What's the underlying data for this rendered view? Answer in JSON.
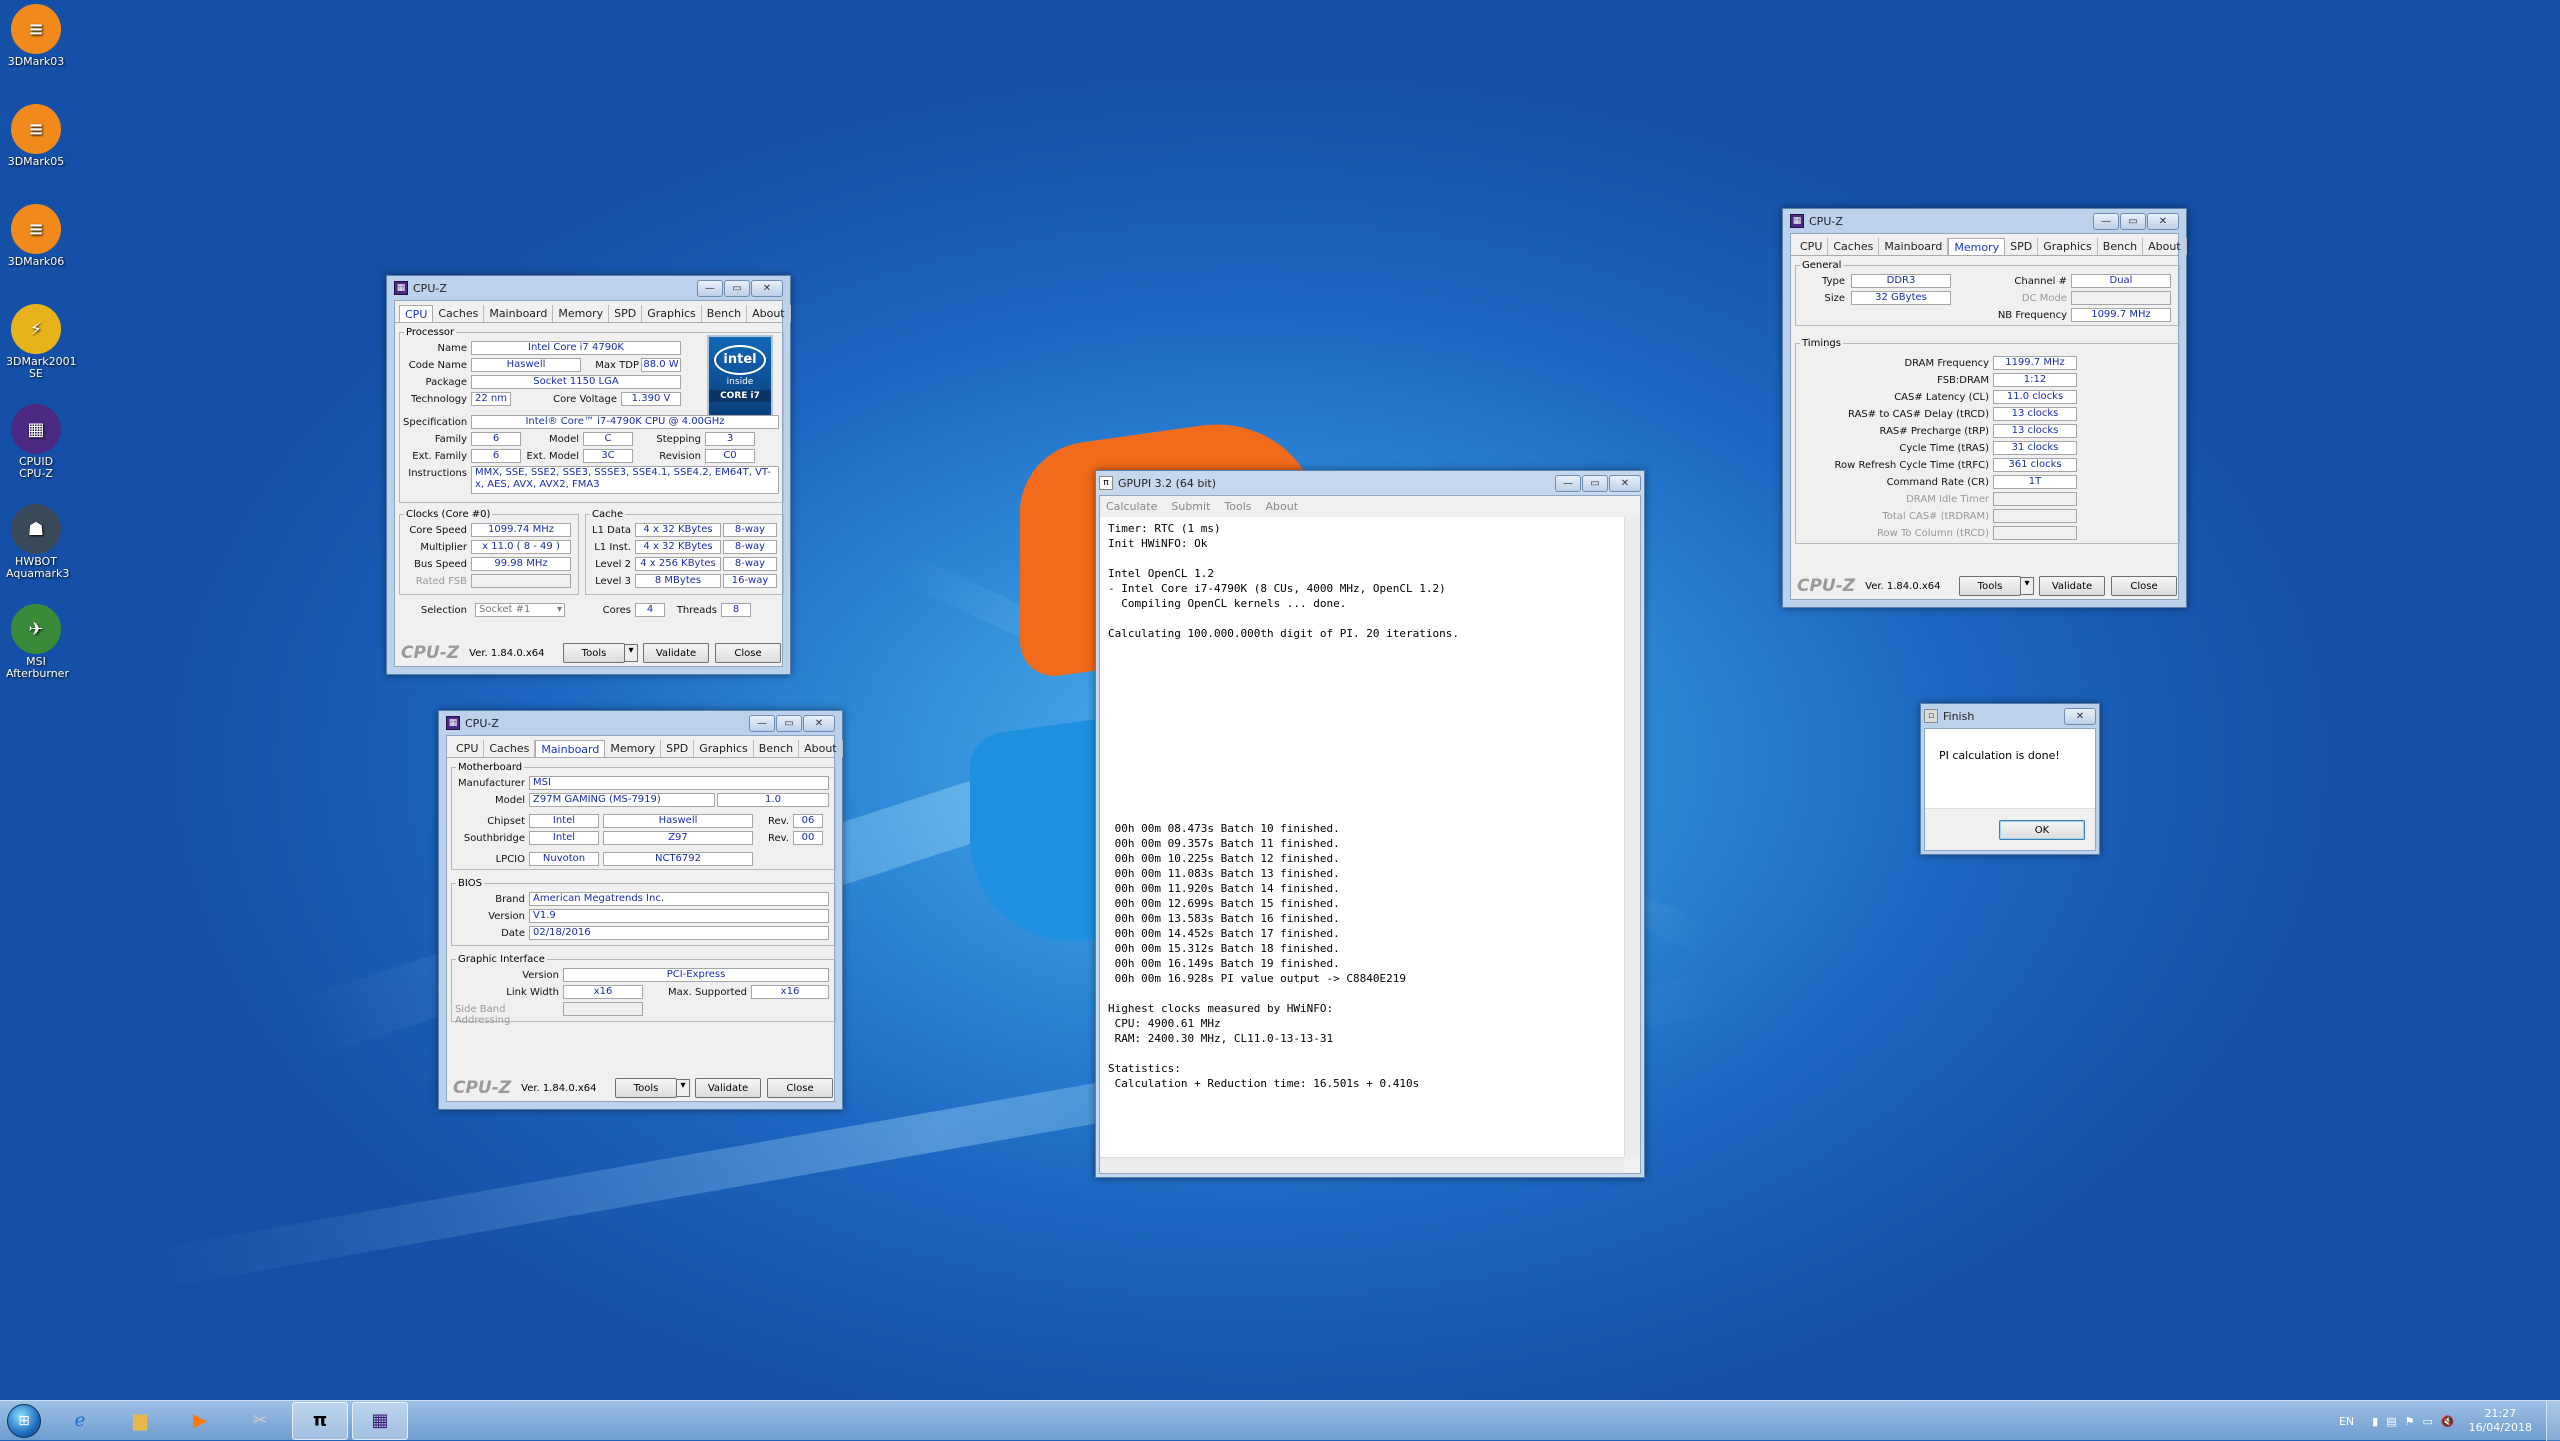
{
  "desktop_icons": [
    {
      "label": "3DMark03",
      "color": "#f08a1c",
      "glyph": "≡"
    },
    {
      "label": "3DMark05",
      "color": "#f08a1c",
      "glyph": "≡"
    },
    {
      "label": "3DMark06",
      "color": "#f08a1c",
      "glyph": "≡"
    },
    {
      "label": "3DMark2001 SE",
      "color": "#e8b31a",
      "glyph": "⚡"
    },
    {
      "label": "CPUID CPU-Z",
      "color": "#4a2a82",
      "glyph": "▦"
    },
    {
      "label": "HWBOT Aquamark3",
      "color": "#3a4a5a",
      "glyph": "☗"
    },
    {
      "label": "MSI Afterburner",
      "color": "#3a8a3a",
      "glyph": "✈"
    }
  ],
  "cpuz_cpu": {
    "title": "CPU-Z",
    "tabs": [
      "CPU",
      "Caches",
      "Mainboard",
      "Memory",
      "SPD",
      "Graphics",
      "Bench",
      "About"
    ],
    "active_tab": "CPU",
    "processor_legend": "Processor",
    "name_label": "Name",
    "name": "Intel Core i7 4790K",
    "codename_label": "Code Name",
    "codename": "Haswell",
    "maxtdp_label": "Max TDP",
    "maxtdp": "88.0 W",
    "package_label": "Package",
    "package": "Socket 1150 LGA",
    "tech_label": "Technology",
    "tech": "22 nm",
    "cv_label": "Core Voltage",
    "cv": "1.390 V",
    "spec_label": "Specification",
    "spec": "Intel® Core™ i7-4790K CPU @ 4.00GHz",
    "family_label": "Family",
    "family": "6",
    "model_label": "Model",
    "model": "C",
    "stepping_label": "Stepping",
    "stepping": "3",
    "extfam_label": "Ext. Family",
    "extfam": "6",
    "extmodel_label": "Ext. Model",
    "extmodel": "3C",
    "revision_label": "Revision",
    "revision": "C0",
    "instr_label": "Instructions",
    "instr": "MMX, SSE, SSE2, SSE3, SSSE3, SSE4.1, SSE4.2, EM64T, VT-x, AES, AVX, AVX2, FMA3",
    "clocks_legend": "Clocks (Core #0)",
    "corespeed_label": "Core Speed",
    "corespeed": "1099.74 MHz",
    "mult_label": "Multiplier",
    "mult": "x 11.0 ( 8 - 49 )",
    "bus_label": "Bus Speed",
    "bus": "99.98 MHz",
    "fsb_label": "Rated FSB",
    "cache_legend": "Cache",
    "l1d_label": "L1 Data",
    "l1d": "4 x 32 KBytes",
    "l1d_way": "8-way",
    "l1i_label": "L1 Inst.",
    "l1i": "4 x 32 KBytes",
    "l1i_way": "8-way",
    "l2_label": "Level 2",
    "l2": "4 x 256 KBytes",
    "l2_way": "8-way",
    "l3_label": "Level 3",
    "l3": "8 MBytes",
    "l3_way": "16-way",
    "selection_label": "Selection",
    "selection": "Socket #1",
    "cores_label": "Cores",
    "cores": "4",
    "threads_label": "Threads",
    "threads": "8",
    "intel_text": "intel",
    "intel_inside": "inside",
    "intel_core": "CORE i7",
    "logo": "CPU-Z",
    "version": "Ver. 1.84.0.x64",
    "tools": "Tools",
    "validate": "Validate",
    "close": "Close"
  },
  "cpuz_mb": {
    "title": "CPU-Z",
    "tabs": [
      "CPU",
      "Caches",
      "Mainboard",
      "Memory",
      "SPD",
      "Graphics",
      "Bench",
      "About"
    ],
    "mb_legend": "Motherboard",
    "manuf_label": "Manufacturer",
    "manuf": "MSI",
    "model_label": "Model",
    "model": "Z97M GAMING (MS-7919)",
    "model_rev": "1.0",
    "chipset_label": "Chipset",
    "chipset": "Intel",
    "chipset_name": "Haswell",
    "rev_label": "Rev.",
    "chipset_rev": "06",
    "sb_label": "Southbridge",
    "sb": "Intel",
    "sb_name": "Z97",
    "sb_rev": "00",
    "lpcio_label": "LPCIO",
    "lpcio": "Nuvoton",
    "lpcio_name": "NCT6792",
    "bios_legend": "BIOS",
    "brand_label": "Brand",
    "brand": "American Megatrends Inc.",
    "version_label": "Version",
    "bios_version": "V1.9",
    "date_label": "Date",
    "date": "02/18/2016",
    "gi_legend": "Graphic Interface",
    "gi_version": "PCI-Express",
    "lw_label": "Link Width",
    "lw": "x16",
    "ms_label": "Max. Supported",
    "ms": "x16",
    "sba_label": "Side Band Addressing",
    "logo": "CPU-Z",
    "version": "Ver. 1.84.0.x64",
    "tools": "Tools",
    "validate": "Validate",
    "close": "Close"
  },
  "cpuz_mem": {
    "title": "CPU-Z",
    "tabs": [
      "CPU",
      "Caches",
      "Mainboard",
      "Memory",
      "SPD",
      "Graphics",
      "Bench",
      "About"
    ],
    "general_legend": "General",
    "type_label": "Type",
    "type": "DDR3",
    "channel_label": "Channel #",
    "channel": "Dual",
    "size_label": "Size",
    "size": "32 GBytes",
    "dcmode_label": "DC Mode",
    "nbfreq_label": "NB Frequency",
    "nbfreq": "1099.7 MHz",
    "timings_legend": "Timings",
    "t": [
      {
        "label": "DRAM Frequency",
        "value": "1199.7 MHz",
        "dis": false
      },
      {
        "label": "FSB:DRAM",
        "value": "1:12",
        "dis": false
      },
      {
        "label": "CAS# Latency (CL)",
        "value": "11.0 clocks",
        "dis": false
      },
      {
        "label": "RAS# to CAS# Delay (tRCD)",
        "value": "13 clocks",
        "dis": false
      },
      {
        "label": "RAS# Precharge (tRP)",
        "value": "13 clocks",
        "dis": false
      },
      {
        "label": "Cycle Time (tRAS)",
        "value": "31 clocks",
        "dis": false
      },
      {
        "label": "Row Refresh Cycle Time (tRFC)",
        "value": "361 clocks",
        "dis": false
      },
      {
        "label": "Command Rate (CR)",
        "value": "1T",
        "dis": false
      },
      {
        "label": "DRAM Idle Timer",
        "value": "",
        "dis": true
      },
      {
        "label": "Total CAS# (tRDRAM)",
        "value": "",
        "dis": true
      },
      {
        "label": "Row To Column (tRCD)",
        "value": "",
        "dis": true
      }
    ],
    "logo": "CPU-Z",
    "version": "Ver. 1.84.0.x64",
    "tools": "Tools",
    "validate": "Validate",
    "close": "Close"
  },
  "gpupi": {
    "title": "GPUPI 3.2 (64 bit)",
    "menu": [
      "Calculate",
      "Submit",
      "Tools",
      "About"
    ],
    "output": "Timer: RTC (1 ms)\nInit HWiNFO: Ok\n\nIntel OpenCL 1.2\n- Intel Core i7-4790K (8 CUs, 4000 MHz, OpenCL 1.2)\n  Compiling OpenCL kernels ... done.\n\nCalculating 100.000.000th digit of PI. 20 iterations.\n\n\n\n\n\n\n\n\n\n\n\n\n 00h 00m 08.473s Batch 10 finished.\n 00h 00m 09.357s Batch 11 finished.\n 00h 00m 10.225s Batch 12 finished.\n 00h 00m 11.083s Batch 13 finished.\n 00h 00m 11.920s Batch 14 finished.\n 00h 00m 12.699s Batch 15 finished.\n 00h 00m 13.583s Batch 16 finished.\n 00h 00m 14.452s Batch 17 finished.\n 00h 00m 15.312s Batch 18 finished.\n 00h 00m 16.149s Batch 19 finished.\n 00h 00m 16.928s PI value output -> C8840E219\n\nHighest clocks measured by HWiNFO:\n CPU: 4900.61 MHz\n RAM: 2400.30 MHz, CL11.0-13-13-31\n\nStatistics:\n Calculation + Reduction time: 16.501s + 0.410s"
  },
  "finish": {
    "title": "Finish",
    "message": "PI calculation is done!",
    "ok": "OK"
  },
  "taskbar": {
    "lang": "EN",
    "time": "21:27",
    "date": "16/04/2018"
  }
}
